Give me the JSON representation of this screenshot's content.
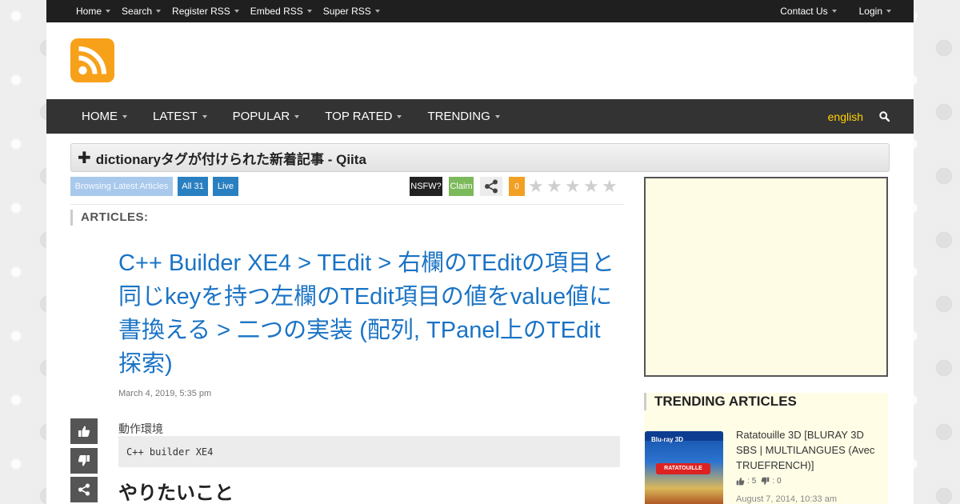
{
  "topbar": {
    "left": [
      "Home",
      "Search",
      "Register RSS",
      "Embed RSS",
      "Super RSS"
    ],
    "right": [
      "Contact Us",
      "Login"
    ]
  },
  "header": {
    "logo_icon": "rss-icon",
    "logo_color": "#f7a11a"
  },
  "mainnav": {
    "items": [
      "HOME",
      "LATEST",
      "POPULAR",
      "TOP RATED",
      "TRENDING"
    ],
    "language": "english",
    "search_icon": "search-icon"
  },
  "page_title": "dictionaryタグが付けられた新着記事 - Qiita",
  "actions": {
    "browsing": "Browsing Latest Articles",
    "all": "All 31",
    "live": "Live",
    "nsfw": "NSFW?",
    "claim": "Claim",
    "count": "0",
    "rating_stars": 5,
    "rating_value": 0
  },
  "articles_label": "ARTICLES:",
  "article": {
    "title": "C++ Builder XE4 > TEdit > 右欄のTEditの項目と同じkeyを持つ左欄のTEdit項目の値をvalue値に書換える > 二つの実装 (配列, TPanel上のTEdit探索)",
    "date": "March 4, 2019, 5:35 pm",
    "env_label": "動作環境",
    "code": "C++ builder XE4",
    "heading": "やりたいこと"
  },
  "trending": {
    "heading": "TRENDING ARTICLES",
    "items": [
      {
        "title": "Ratatouille 3D [BLURAY 3D SBS | MULTILANGUES (Avec TRUEFRENCH)]",
        "cover_brand": "Blu-ray 3D",
        "cover_title": "RATATOUILLE",
        "likes": "5",
        "dislikes": "0",
        "date": "August 7, 2014, 10:33 am"
      }
    ]
  },
  "colors": {
    "accent_blue": "#2a7fc1",
    "title_blue": "#1a73c5",
    "claim_green": "#7cb95a",
    "count_orange": "#f2a024",
    "lang_yellow": "#ffd200"
  }
}
